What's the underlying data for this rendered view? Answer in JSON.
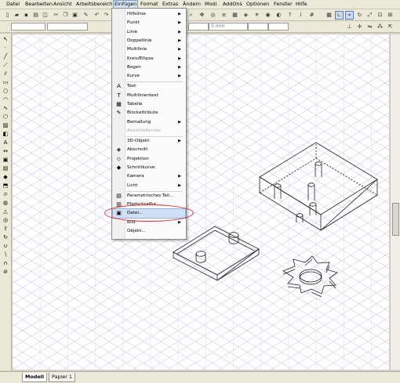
{
  "menubar": {
    "items": [
      "Datei",
      "Bearbeiten",
      "Ansicht",
      "Arbeitsbereich",
      "Einfügen",
      "Format",
      "Extras",
      "Ändern",
      "Modi",
      "AddOns",
      "Optionen",
      "Fenster",
      "Hilfe"
    ]
  },
  "toolbar": {
    "field_mm": "0 mm"
  },
  "menu": {
    "items": [
      {
        "label": "Hilfslinie",
        "icon": "",
        "submenu": true
      },
      {
        "label": "Punkt",
        "icon": "",
        "submenu": true
      },
      {
        "label": "Linie",
        "icon": "",
        "submenu": true
      },
      {
        "label": "Doppellinie",
        "icon": "",
        "submenu": true
      },
      {
        "label": "Multilinie",
        "icon": "",
        "submenu": true
      },
      {
        "label": "Kreis/Ellipse",
        "icon": "",
        "submenu": true
      },
      {
        "label": "Bogen",
        "icon": "",
        "submenu": true
      },
      {
        "label": "Kurve",
        "icon": "",
        "submenu": true
      },
      {
        "label": "Text",
        "icon": "A"
      },
      {
        "label": "Multilinientext",
        "icon": "T"
      },
      {
        "label": "Tabelle",
        "icon": "▦"
      },
      {
        "label": "Blockattribute",
        "icon": "✎"
      },
      {
        "label": "Bemaßung",
        "icon": "",
        "submenu": true
      },
      {
        "label": "Ansichtsfenster",
        "icon": "",
        "disabled": true
      },
      {
        "label": "3D-Objekt",
        "icon": "",
        "submenu": true
      },
      {
        "label": "Abschnitt",
        "icon": "◈"
      },
      {
        "label": "Projektion",
        "icon": "◇"
      },
      {
        "label": "Schnittkurve",
        "icon": "◆"
      },
      {
        "label": "Kamera",
        "icon": "",
        "submenu": true
      },
      {
        "label": "Licht",
        "icon": "",
        "submenu": true
      },
      {
        "label": "Parametrisches Teil...",
        "icon": "▤"
      },
      {
        "label": "Pfadschraffur",
        "icon": "▥"
      },
      {
        "label": "Datei...",
        "icon": "▣",
        "highlighted": true
      },
      {
        "label": "Bild",
        "icon": "",
        "submenu": true
      },
      {
        "label": "Objekt...",
        "icon": ""
      }
    ]
  },
  "tabs": {
    "model": "Modell",
    "paper": "Papier 1"
  },
  "colors": {
    "highlight_ring": "#d8252a",
    "grid": "#c9cfe6",
    "menu_highlight": "#cfe0f7"
  }
}
